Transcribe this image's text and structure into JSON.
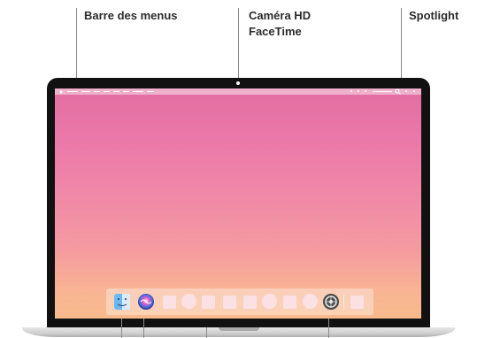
{
  "callouts": {
    "menu_bar": "Barre des menus",
    "camera_line1": "Caméra HD",
    "camera_line2": "FaceTime",
    "spotlight": "Spotlight"
  },
  "menubar_icons": [
    "apple-icon",
    "search-icon"
  ],
  "dock_icons": [
    "finder-icon",
    "siri-icon",
    "system-preferences-icon"
  ],
  "colors": {
    "wallpaper_top": "#e36ea2",
    "wallpaper_bottom": "#f8bb8c",
    "bezel": "#111111",
    "leader_line": "#8a8a8a"
  }
}
